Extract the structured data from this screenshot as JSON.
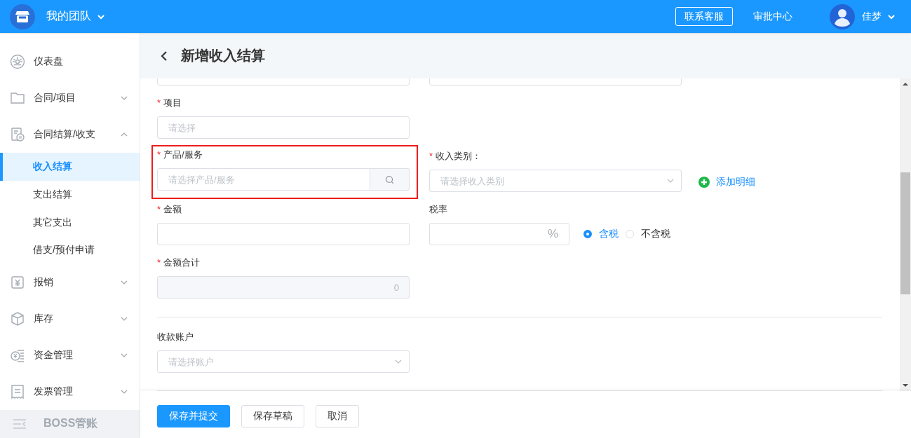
{
  "topbar": {
    "team": "我的团队",
    "buttons": [
      {
        "label": "联系客服",
        "kind": "outlined"
      },
      {
        "label": "审批中心",
        "kind": "plain"
      }
    ],
    "user": "佳梦"
  },
  "sidebar": {
    "items": [
      {
        "label": "仪表盘"
      },
      {
        "label": "合同/项目",
        "expanded": false
      },
      {
        "label": "合同结算/收支",
        "expanded": true,
        "children": [
          {
            "label": "收入结算",
            "selected": true
          },
          {
            "label": "支出结算",
            "selected": false
          },
          {
            "label": "其它支出",
            "selected": false
          },
          {
            "label": "借支/预付申请",
            "selected": false
          }
        ]
      },
      {
        "label": "报销",
        "expanded": false
      },
      {
        "label": "库存",
        "expanded": false
      },
      {
        "label": "资金管理",
        "expanded": false
      },
      {
        "label": "发票管理",
        "expanded": false
      }
    ],
    "brand": "BOSS管账"
  },
  "page": {
    "title": "新增收入结算"
  },
  "form": {
    "rows": [
      {
        "kind": "fields",
        "fields": [
          {
            "kind": "text"
          },
          {
            "kind": "text"
          }
        ]
      },
      {
        "kind": "fields",
        "fields": [
          {
            "kind": "text",
            "required_mark": "*",
            "label": "项目",
            "placeholder": "请选择"
          }
        ]
      },
      {
        "kind": "fields",
        "fields": [
          {
            "kind": "search",
            "required_mark": "*",
            "label": "产品/服务",
            "placeholder": "请选择产品/服务",
            "highlighted": true
          },
          {
            "kind": "select",
            "required_mark": "*",
            "label": "收入类别：",
            "placeholder": "请选择收入类别"
          },
          {
            "kind": "action",
            "label": "添加明细"
          }
        ]
      },
      {
        "kind": "fields",
        "fields": [
          {
            "kind": "text",
            "required_mark": "*",
            "label": "金额"
          },
          {
            "kind": "percent",
            "label": "税率",
            "suffix": "%",
            "options": [
              {
                "label": "含税",
                "selected": true
              },
              {
                "label": "不含税",
                "selected": false
              }
            ]
          }
        ]
      },
      {
        "kind": "fields",
        "fields": [
          {
            "kind": "text",
            "required_mark": "*",
            "label": "金额合计",
            "value": "0",
            "disabled": true
          }
        ]
      },
      {
        "kind": "divider"
      },
      {
        "kind": "fields",
        "fields": [
          {
            "kind": "select",
            "label": "收款账户",
            "placeholder": "请选择账户"
          }
        ]
      },
      {
        "kind": "divider"
      }
    ]
  },
  "footer": {
    "buttons": [
      {
        "label": "保存并提交",
        "kind": "primary"
      },
      {
        "label": "保存草稿",
        "kind": "default"
      },
      {
        "label": "取消",
        "kind": "default"
      }
    ]
  }
}
